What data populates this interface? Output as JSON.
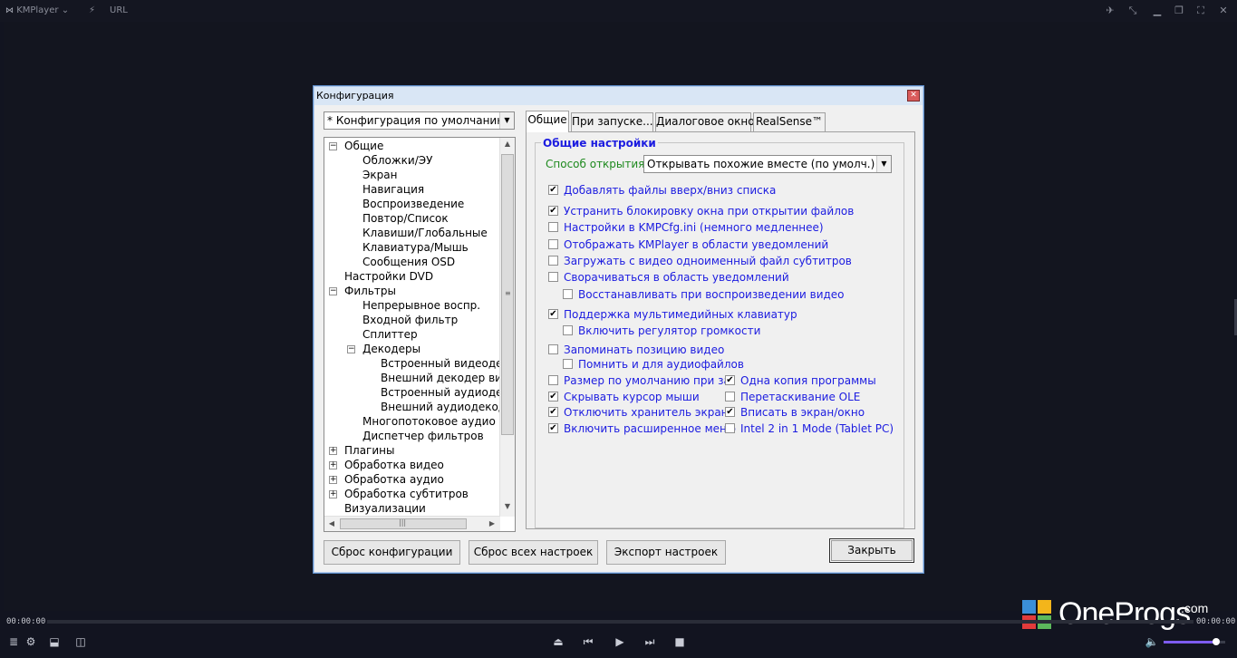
{
  "player": {
    "brand": "KMPlayer",
    "brand_caret": "⌄",
    "bolt_icon": "⚡",
    "url_label": "URL",
    "time_left": "00:00:00",
    "time_right": "00:00:00",
    "accent": "#7d5cf0",
    "volume_level": 0.85
  },
  "watermark": {
    "name": "OneProgs",
    "suffix": ".com"
  },
  "dialog": {
    "title": "Конфигурация",
    "preset": "* Конфигурация по умолчанию",
    "tree": [
      {
        "label": "Общие",
        "toggle": "−"
      },
      {
        "label": "Обложки/ЭУ"
      },
      {
        "label": "Экран"
      },
      {
        "label": "Навигация"
      },
      {
        "label": "Воспроизведение"
      },
      {
        "label": "Повтор/Список"
      },
      {
        "label": "Клавиши/Глобальные"
      },
      {
        "label": "Клавиатура/Мышь"
      },
      {
        "label": "Сообщения OSD"
      },
      {
        "label": "Настройки DVD"
      },
      {
        "label": "Фильтры",
        "toggle": "−"
      },
      {
        "label": "Непрерывное воспр."
      },
      {
        "label": "Входной фильтр"
      },
      {
        "label": "Сплиттер"
      },
      {
        "label": "Декодеры",
        "toggle": "−"
      },
      {
        "label": "Встроенный видеодекодер"
      },
      {
        "label": "Внешний декодер видео"
      },
      {
        "label": "Встроенный аудиодекодер"
      },
      {
        "label": "Внешний аудиодекодер"
      },
      {
        "label": "Многопотоковое аудио"
      },
      {
        "label": "Диспетчер фильтров"
      },
      {
        "label": "Плагины",
        "toggle": "+"
      },
      {
        "label": "Обработка видео",
        "toggle": "+"
      },
      {
        "label": "Обработка аудио",
        "toggle": "+"
      },
      {
        "label": "Обработка субтитров",
        "toggle": "+"
      },
      {
        "label": "Визуализации"
      }
    ],
    "tabs": [
      "Общие",
      "При запуске...",
      "Диалоговое окно",
      "RealSense™"
    ],
    "group_title": "Общие настройки",
    "open_mode_label": "Способ открытия:",
    "open_mode_value": "Открывать похожие вместе (по умолч.)",
    "options": [
      {
        "label": "Добавлять файлы вверх/вниз списка",
        "checked": true
      },
      {
        "label": "Устранить блокировку окна при открытии файлов",
        "checked": true
      },
      {
        "label": "Настройки в KMPCfg.ini (немного медленнее)",
        "checked": false
      },
      {
        "label": "Отображать KMPlayer в области уведомлений",
        "checked": false
      },
      {
        "label": "Загружать с видео одноименный файл субтитров",
        "checked": false
      },
      {
        "label": "Сворачиваться в область уведомлений",
        "checked": false
      },
      {
        "label": "Восстанавливать при воспроизведении видео",
        "checked": false
      },
      {
        "label": "Поддержка мультимедийных клавиатур",
        "checked": true
      },
      {
        "label": "Включить регулятор громкости",
        "checked": false
      },
      {
        "label": "Запоминать позицию видео",
        "checked": false
      },
      {
        "label": "Помнить и для аудиофайлов",
        "checked": false
      },
      {
        "label": "Размер по умолчанию при закрытии",
        "checked": false
      },
      {
        "label": "Скрывать курсор мыши",
        "checked": true
      },
      {
        "label": "Отключить хранитель экрана",
        "checked": true
      },
      {
        "label": "Включить расширенное меню",
        "checked": true
      },
      {
        "label": "Одна копия программы",
        "checked": true
      },
      {
        "label": "Перетаскивание OLE",
        "checked": false
      },
      {
        "label": "Вписать в экран/окно",
        "checked": true
      },
      {
        "label": "Intel 2 in 1 Mode (Tablet PC)",
        "checked": false
      }
    ],
    "buttons": {
      "reset_config": "Сброс конфигурации",
      "reset_all": "Сброс всех настроек",
      "export": "Экспорт настроек",
      "close": "Закрыть"
    }
  }
}
